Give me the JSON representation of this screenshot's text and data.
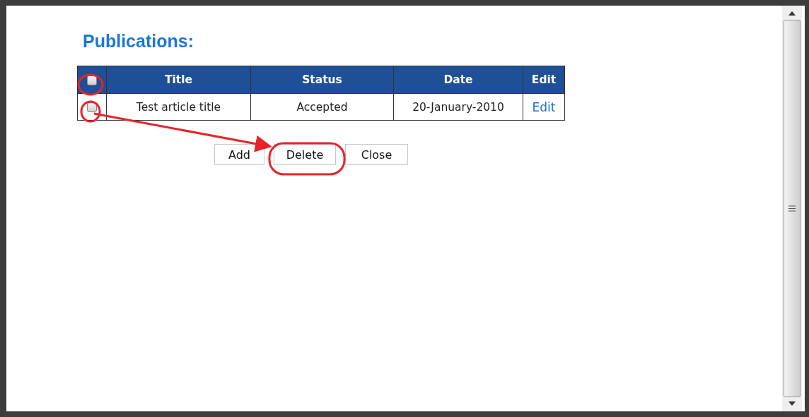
{
  "heading": "Publications:",
  "table": {
    "select_all": {
      "checked": false
    },
    "columns": [
      "Title",
      "Status",
      "Date",
      "Edit"
    ],
    "rows": [
      {
        "checked": false,
        "title": "Test article title",
        "status": "Accepted",
        "date": "20-January-2010",
        "edit": "Edit"
      }
    ]
  },
  "buttons": [
    "Add",
    "Delete",
    "Close"
  ]
}
